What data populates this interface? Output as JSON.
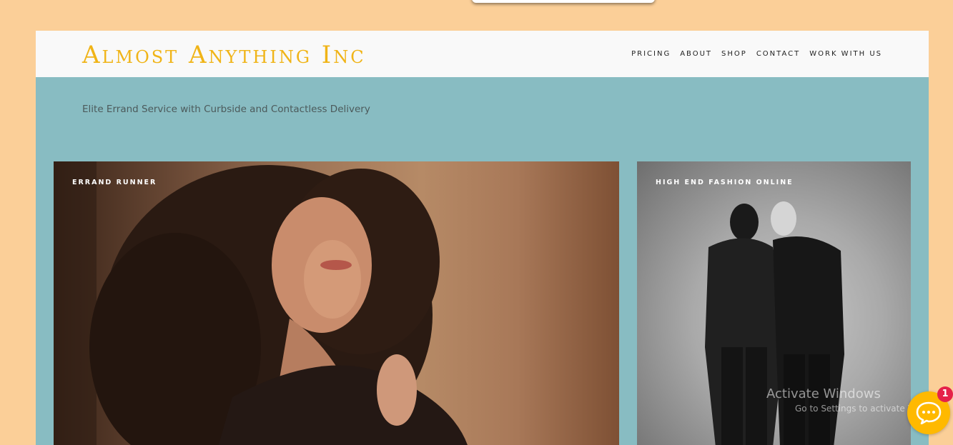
{
  "site": {
    "title": "Almost Anything Inc",
    "tagline": "Elite Errand Service with Curbside and Contactless Delivery"
  },
  "nav": {
    "items": [
      {
        "label": "PRICING"
      },
      {
        "label": "ABOUT"
      },
      {
        "label": "SHOP"
      },
      {
        "label": "CONTACT"
      },
      {
        "label": "WORK WITH US"
      }
    ]
  },
  "cards": [
    {
      "label": "ERRAND RUNNER",
      "image": "woman-portrait-photo"
    },
    {
      "label": "HIGH END FASHION ONLINE",
      "image": "two-men-in-suits-photo"
    }
  ],
  "watermark": {
    "line1": "Activate Windows",
    "line2": "Go to Settings to activate Windows."
  },
  "chat": {
    "badge_count": "1",
    "icon": "speech-bubble-icon"
  },
  "colors": {
    "page_background": "#fbcf98",
    "site_background": "#88bcc2",
    "header_background": "#f9f9f9",
    "title_accent": "#f0b417",
    "chat_button": "#ffb900",
    "badge": "#e5214a"
  }
}
